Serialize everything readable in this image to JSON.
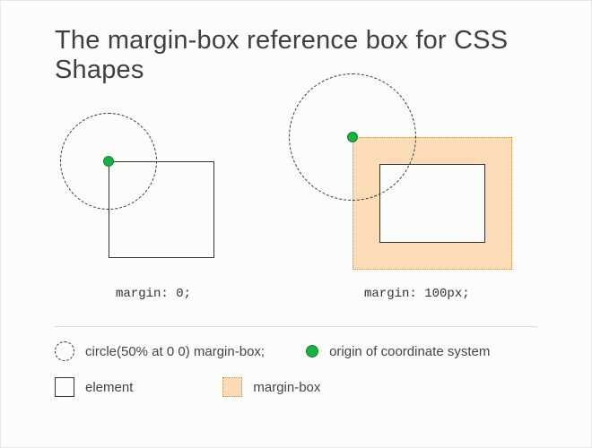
{
  "title": "The margin-box reference box for CSS Shapes",
  "diagrams": {
    "left": {
      "caption": "margin: 0;"
    },
    "right": {
      "caption": "margin: 100px;"
    }
  },
  "legend": {
    "circle_fn": "circle(50% at 0 0) margin-box;",
    "origin": "origin of coordinate system",
    "element": "element",
    "marginbox": "margin-box"
  },
  "colors": {
    "accent_green": "#18b244",
    "margin_fill": "#fcdcb7",
    "margin_border": "#d08b3d"
  }
}
